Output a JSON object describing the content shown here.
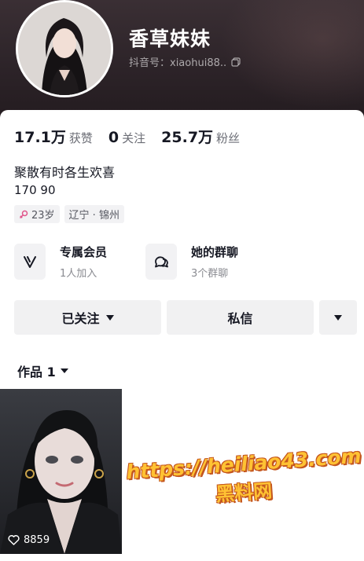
{
  "profile": {
    "nickname": "香草妹妹",
    "douyin_id": "抖音号：xiaohui88..",
    "bio_line1": "聚散有时各生欢喜",
    "bio_line2": "170 90"
  },
  "stats": [
    {
      "num": "17.1万",
      "label": "获赞"
    },
    {
      "num": "0",
      "label": "关注"
    },
    {
      "num": "25.7万",
      "label": "粉丝"
    }
  ],
  "tags": {
    "age": "23岁",
    "location": "辽宁 · 锦州"
  },
  "features": {
    "membership_title": "专属会员",
    "membership_sub": "1人加入",
    "group_title": "她的群聊",
    "group_sub": "3个群聊"
  },
  "actions": {
    "following_label": "已关注",
    "message_label": "私信"
  },
  "works": {
    "tab_label": "作品 1",
    "video_likes": "8859"
  },
  "watermark": {
    "line1": "https://heiliao43.com",
    "line2": "黑料网"
  },
  "colors": {
    "header_bg": "#2c2328",
    "button_bg": "#f1f1f2",
    "watermark_fill": "#ffc233",
    "watermark_stroke": "#c4561e",
    "female_icon": "#e0558b"
  }
}
